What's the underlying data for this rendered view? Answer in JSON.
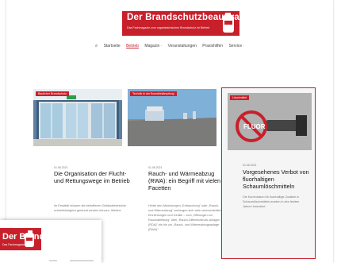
{
  "site": {
    "logo_title": "Der Brandschutzbeauftragte",
    "logo_subtitle": "Das Fachmagazin zum organisatorischen Brandschutz im Betrieb"
  },
  "nav": {
    "items": [
      {
        "label": "Startseite"
      },
      {
        "label": "Betrieb",
        "active": true
      },
      {
        "label": "Magazin ·"
      },
      {
        "label": "Veranstaltungen"
      },
      {
        "label": "Praxishilfen"
      },
      {
        "label": "Service ·"
      }
    ]
  },
  "articles": [
    {
      "category": "Baulicher Brandschutz",
      "date": "01.06.2021",
      "title": "Die Organisation der Flucht- und Rettungswege im Betrieb",
      "excerpt": "Im Ernstfall müssen die betroffenen Gebäudebereiche schnellstmöglich geräumt werden können. Welche"
    },
    {
      "category": "Technik in der Brandbekämpfung",
      "date": "01.06.2021",
      "title": "Rauch- und Wärmeabzug (RWA): ein Begriff mit vielen Facetten",
      "excerpt": "Hinter den Abkürzungen „Entrauchung\" oder „Rauch- und Wärmeabzug\" verbergen sich viele unterschiedliche Einrichtungen und Geräte – vom „Öffnungen zur Rauchableitung\" über „Rauch-Differenzdruck-Anlagen (RDA)\" bis hin zur „Rauch- und Wärmeabzugsanlage (RWA)\"."
    },
    {
      "category": "Löschmittel",
      "date": "01.06.2021",
      "title": "Vorgesehenes Verbot von fluorhaltigen Schaumlöschmitteln",
      "excerpt": "Die Kommission für fluorhaltige Zusätze in Schaumlöschmitteln wurden in den letzten Jahren formuliert.",
      "thumb_text": "FLUOR"
    }
  ],
  "popup": {
    "logo_title": "Der Brandschutzbeauftragte",
    "logo_subtitle": "Das Fachmagazin"
  }
}
